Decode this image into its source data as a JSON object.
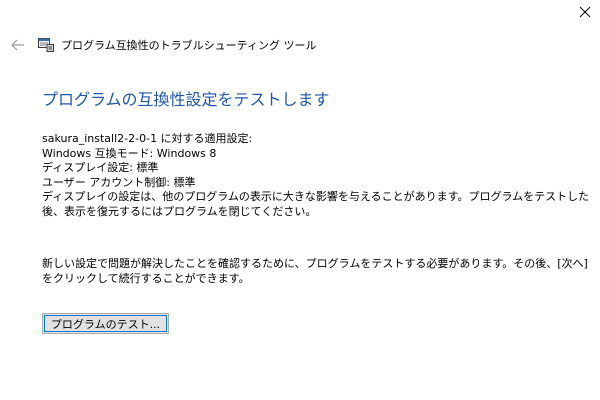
{
  "window": {
    "close_icon": "close-icon",
    "back_icon": "back-arrow-icon",
    "app_icon": "program-compatibility-icon",
    "title": "プログラム互換性のトラブルシューティング ツール"
  },
  "main": {
    "heading": "プログラムの互換性設定をテストします",
    "settings": {
      "applied_for": "sakura_install2-2-0-1 に対する適用設定:",
      "compat_mode": "Windows 互換モード: Windows 8",
      "display": "ディスプレイ設定: 標準",
      "uac": "ユーザー アカウント制御: 標準",
      "warning": "ディスプレイの設定は、他のプログラムの表示に大きな影響を与えることがあります。プログラムをテストした後、表示を復元するにはプログラムを閉じてください。"
    },
    "note": "新しい設定で問題が解決したことを確認するために、プログラムをテストする必要があります。その後、[次へ] をクリックして続行することができます。",
    "test_button_label": "プログラムのテスト..."
  },
  "colors": {
    "heading": "#1f57a8",
    "button_face": "#e1e1e1",
    "button_border": "#adadad",
    "focus": "#0078d7"
  }
}
